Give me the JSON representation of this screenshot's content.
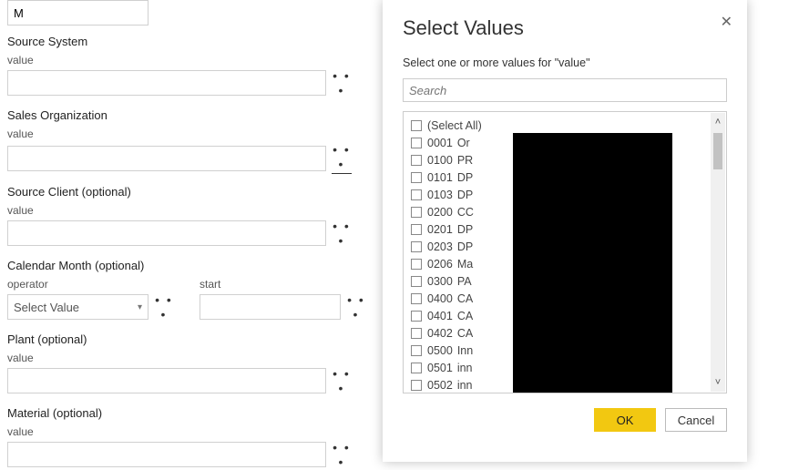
{
  "top_input_value": "M",
  "fields": {
    "source_system": {
      "label": "Source System",
      "sub": "value",
      "value": ""
    },
    "sales_org": {
      "label": "Sales Organization",
      "sub": "value",
      "value": ""
    },
    "source_client": {
      "label": "Source Client (optional)",
      "sub": "value",
      "value": ""
    },
    "calendar_month": {
      "label": "Calendar Month (optional)",
      "operator_label": "operator",
      "operator_value": "Select Value",
      "start_label": "start",
      "start_value": ""
    },
    "plant": {
      "label": "Plant (optional)",
      "sub": "value",
      "value": ""
    },
    "material": {
      "label": "Material (optional)",
      "sub": "value",
      "value": ""
    }
  },
  "more_glyph": "• • •",
  "dialog": {
    "title": "Select Values",
    "subtitle": "Select one or more values for \"value\"",
    "search_placeholder": "Search",
    "select_all": "(Select All)",
    "items": [
      {
        "code": "0001",
        "desc": "Or"
      },
      {
        "code": "0100",
        "desc": "PR"
      },
      {
        "code": "0101",
        "desc": "DP"
      },
      {
        "code": "0103",
        "desc": "DP"
      },
      {
        "code": "0200",
        "desc": "CC"
      },
      {
        "code": "0201",
        "desc": "DP"
      },
      {
        "code": "0203",
        "desc": "DP"
      },
      {
        "code": "0206",
        "desc": "Ma"
      },
      {
        "code": "0300",
        "desc": "PA"
      },
      {
        "code": "0400",
        "desc": "CA"
      },
      {
        "code": "0401",
        "desc": "CA"
      },
      {
        "code": "0402",
        "desc": "CA"
      },
      {
        "code": "0500",
        "desc": "Inn"
      },
      {
        "code": "0501",
        "desc": "inn"
      },
      {
        "code": "0502",
        "desc": "inn"
      }
    ],
    "ok_label": "OK",
    "cancel_label": "Cancel"
  }
}
